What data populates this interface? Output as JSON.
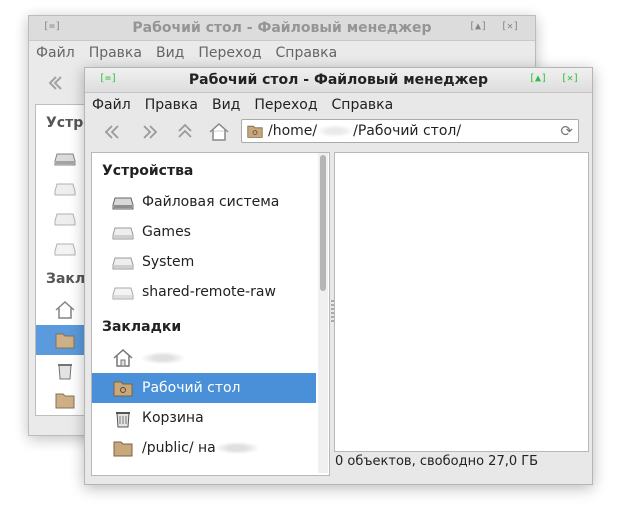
{
  "back_window": {
    "title": "Рабочий стол - Файловый менеджер",
    "btn_left": "[=]",
    "btn_max": "[▲]",
    "btn_close": "[✕]",
    "menu": [
      "Файл",
      "Правка",
      "Вид",
      "Переход",
      "Справка"
    ],
    "sidebar": {
      "devices_head": "Устро",
      "bookmarks_head": "Закла"
    }
  },
  "front_window": {
    "title": "Рабочий стол - Файловый менеджер",
    "btn_left": "[=]",
    "btn_max": "[▲]",
    "btn_close": "[✕]",
    "menu": [
      "Файл",
      "Правка",
      "Вид",
      "Переход",
      "Справка"
    ],
    "address": {
      "prefix": "/home/",
      "suffix": "/Рабочий стол/"
    },
    "sidebar": {
      "devices_head": "Устройства",
      "devices": [
        "Файловая система",
        "Games",
        "System",
        "shared-remote-raw"
      ],
      "bookmarks_head": "Закладки",
      "bookmarks": [
        "",
        "Рабочий стол",
        "Корзина",
        "/public/ на"
      ]
    },
    "status": "0 объектов, свободно 27,0 ГБ"
  }
}
